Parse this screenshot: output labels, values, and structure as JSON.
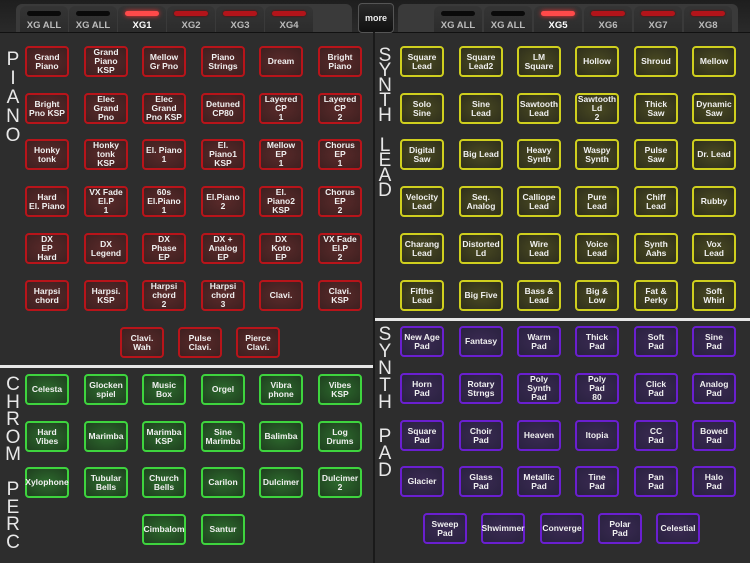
{
  "topbar": {
    "left_tabs": [
      {
        "label": "XG ALL",
        "indicator": "off",
        "active": false
      },
      {
        "label": "XG ALL",
        "indicator": "off",
        "active": false
      },
      {
        "label": "XG1",
        "indicator": "red",
        "active": true
      },
      {
        "label": "XG2",
        "indicator": "red",
        "active": false
      },
      {
        "label": "XG3",
        "indicator": "red",
        "active": false
      },
      {
        "label": "XG4",
        "indicator": "red",
        "active": false
      }
    ],
    "more_label": "more",
    "right_tabs": [
      {
        "label": "XG ALL",
        "indicator": "off",
        "active": false
      },
      {
        "label": "XG ALL",
        "indicator": "off",
        "active": false
      },
      {
        "label": "XG5",
        "indicator": "red",
        "active": true
      },
      {
        "label": "XG6",
        "indicator": "red",
        "active": false
      },
      {
        "label": "XG7",
        "indicator": "red",
        "active": false
      },
      {
        "label": "XG8",
        "indicator": "red",
        "active": false
      }
    ]
  },
  "colors": {
    "piano": "#b8141a",
    "synth_lead": "#cfcf1e",
    "chrom_perc": "#3ed43e",
    "synth_pad": "#6a1fd0",
    "active_indicator": "#ff4a4a"
  },
  "sections": {
    "piano": {
      "title": "P\nI\nA\nN\nO",
      "buttons": [
        "Grand\nPiano",
        "Grand\nPiano\nKSP",
        "Mellow\nGr Pno",
        "Piano\nStrings",
        "Dream",
        "Bright\nPiano",
        "Bright\nPno KSP",
        "Elec\nGrand\nPno",
        "Elec\nGrand\nPno KSP",
        "Detuned\nCP80",
        "Layered\nCP\n1",
        "Layered\nCP\n2",
        "Honky\ntonk",
        "Honky\ntonk\nKSP",
        "El. Piano\n1",
        "El.\nPiano1\nKSP",
        "Mellow\nEP\n1",
        "Chorus\nEP\n1",
        "Hard\nEl. Piano",
        "VX Fade\nEl.P\n1",
        "60s\nEl.Piano\n1",
        "El.Piano\n2",
        "El.\nPiano2\nKSP",
        "Chorus\nEP\n2",
        "DX\nEP\nHard",
        "DX\nLegend",
        "DX\nPhase\nEP",
        "DX +\nAnalog\nEP",
        "DX\nKoto\nEP",
        "VX Fade\nEl.P\n2",
        "Harpsi\nchord",
        "Harpsi.\nKSP",
        "Harpsi\nchord\n2",
        "Harpsi\nchord\n3",
        "Clavi.",
        "Clavi.\nKSP",
        "Clavi.\nWah",
        "Pulse\nClavi.",
        "Pierce\nClavi."
      ]
    },
    "chrom_perc": {
      "title": "C\nH\nR\nO\nM\n \nP\nE\nR\nC",
      "buttons": [
        "Celesta",
        "Glocken\nspiel",
        "Music\nBox",
        "Orgel",
        "Vibra\nphone",
        "Vibes\nKSP",
        "Hard\nVibes",
        "Marimba",
        "Marimba\nKSP",
        "Sine\nMarimba",
        "Balimba",
        "Log\nDrums",
        "Xylophone",
        "Tubular\nBells",
        "Church\nBells",
        "Carilon",
        "Dulcimer",
        "Dulcimer\n2",
        "Cimbalom",
        "Santur"
      ]
    },
    "synth_lead": {
      "title": "S\nY\nN\nT\nH\n \nL\nE\nA\nD",
      "buttons": [
        "Square\nLead",
        "Square\nLead2",
        "LM\nSquare",
        "Hollow",
        "Shroud",
        "Mellow",
        "Solo\nSine",
        "Sine\nLead",
        "Sawtooth\nLead",
        "Sawtooth\nLd\n2",
        "Thick\nSaw",
        "Dynamic\nSaw",
        "Digital\nSaw",
        "Big Lead",
        "Heavy\nSynth",
        "Waspy\nSynth",
        "Pulse\nSaw",
        "Dr. Lead",
        "Velocity\nLead",
        "Seq.\nAnalog",
        "Calliope\nLead",
        "Pure\nLead",
        "Chiff\nLead",
        "Rubby",
        "Charang\nLead",
        "Distorted\nLd",
        "Wire\nLead",
        "Voice\nLead",
        "Synth\nAahs",
        "Vox\nLead",
        "Fifths\nLead",
        "Big Five",
        "Bass &\nLead",
        "Big &\nLow",
        "Fat &\nPerky",
        "Soft\nWhirl"
      ]
    },
    "synth_pad": {
      "title": "S\nY\nN\nT\nH\n \nP\nA\nD",
      "buttons": [
        "New Age\nPad",
        "Fantasy",
        "Warm\nPad",
        "Thick\nPad",
        "Soft\nPad",
        "Sine\nPad",
        "Horn\nPad",
        "Rotary\nStrngs",
        "Poly\nSynth\nPad",
        "Poly\nPad\n80",
        "Click\nPad",
        "Analog\nPad",
        "Square\nPad",
        "Choir\nPad",
        "Heaven",
        "Itopia",
        "CC\nPad",
        "Bowed\nPad",
        "Glacier",
        "Glass\nPad",
        "Metallic\nPad",
        "Tine\nPad",
        "Pan\nPad",
        "Halo\nPad",
        "Sweep\nPad",
        "Shwimmer",
        "Converge",
        "Polar\nPad",
        "Celestial"
      ]
    }
  }
}
